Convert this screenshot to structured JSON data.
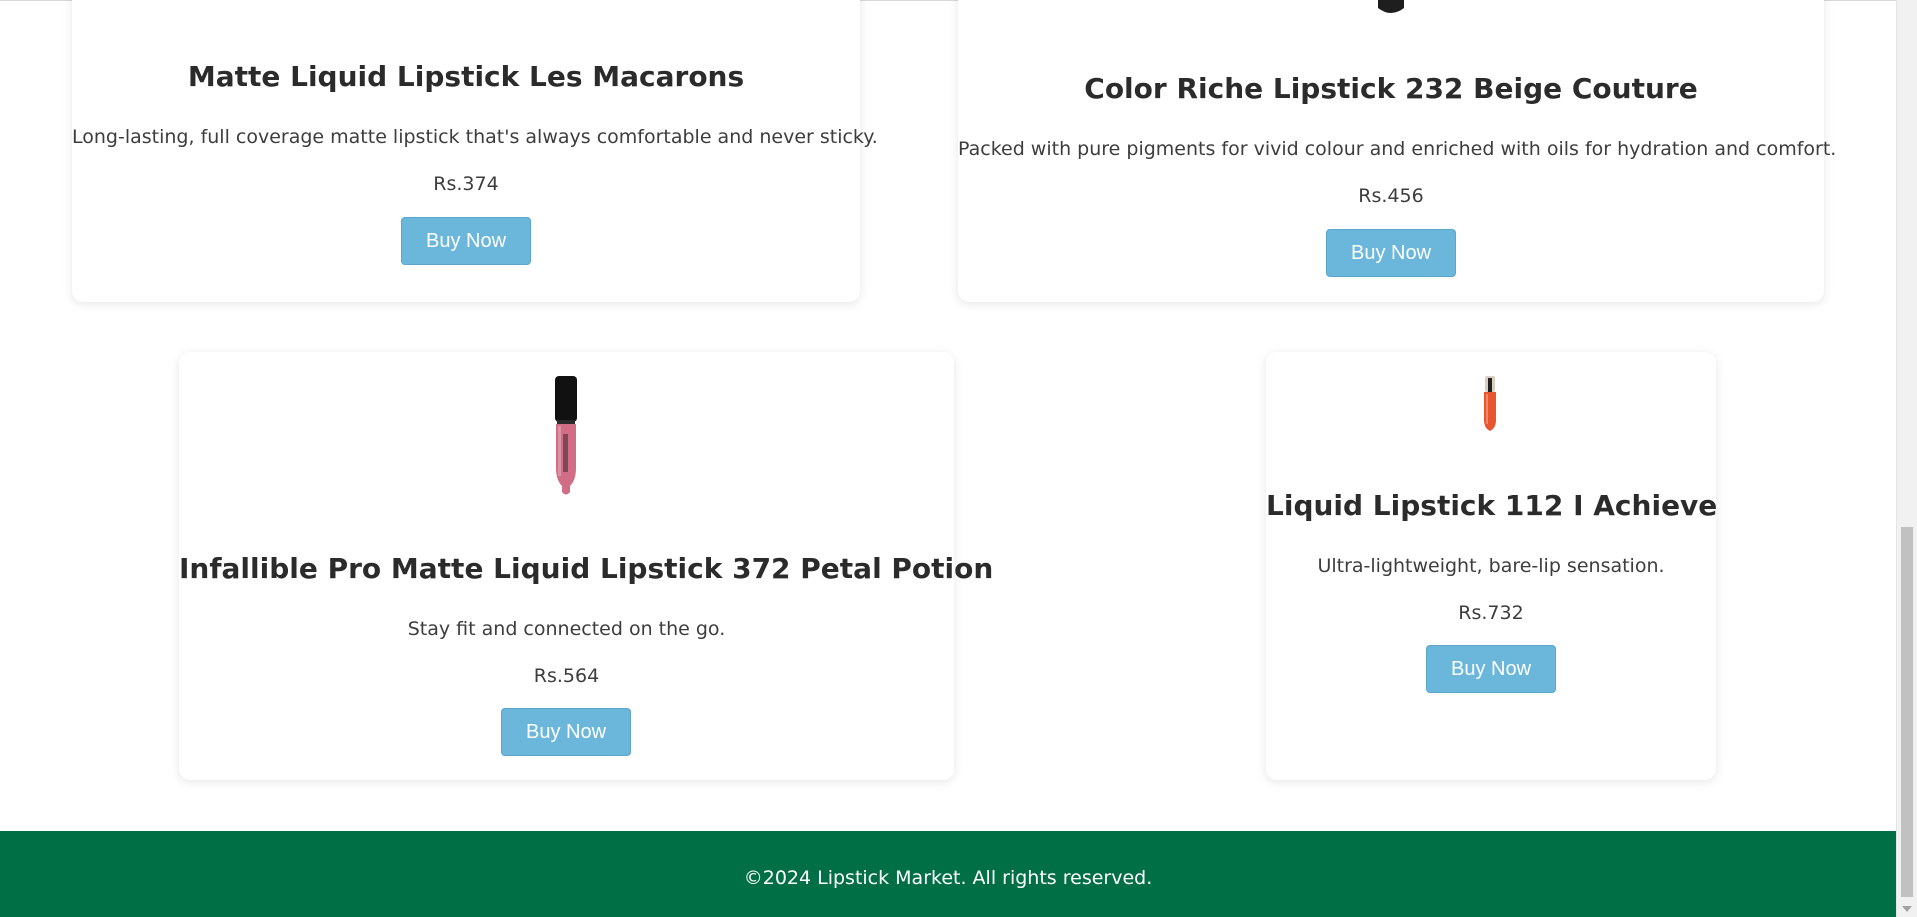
{
  "products": [
    {
      "name": "Matte Liquid Lipstick Les Macarons",
      "description": "Long-lasting, full coverage matte lipstick that's always comfortable and never sticky.",
      "price": "Rs.374",
      "button_label": "Buy Now",
      "image_icon": "lipstick-tube-icon",
      "image_color": "#d8456c"
    },
    {
      "name": "Color Riche Lipstick 232 Beige Couture",
      "description": "Packed with pure pigments for vivid colour and enriched with oils for hydration and comfort.",
      "price": "Rs.456",
      "button_label": "Buy Now",
      "image_icon": "lipstick-bullet-icon",
      "image_color": "#1e1e1e"
    },
    {
      "name": "Infallible Pro Matte Liquid Lipstick 372 Petal Potion",
      "description": "Stay fit and connected on the go.",
      "price": "Rs.564",
      "button_label": "Buy Now",
      "image_icon": "liquid-lipstick-pink-icon",
      "image_color": "#d26d86"
    },
    {
      "name": "Liquid Lipstick 112 I Achieve",
      "description": "Ultra-lightweight, bare-lip sensation.",
      "price": "Rs.732",
      "button_label": "Buy Now",
      "image_icon": "liquid-lipstick-orange-icon",
      "image_color": "#e8562f"
    }
  ],
  "footer": {
    "copyright": "©2024 Lipstick Market. All rights reserved."
  },
  "colors": {
    "button": "#6bb6db",
    "footer": "#006f45",
    "text": "#2b2b2b"
  }
}
